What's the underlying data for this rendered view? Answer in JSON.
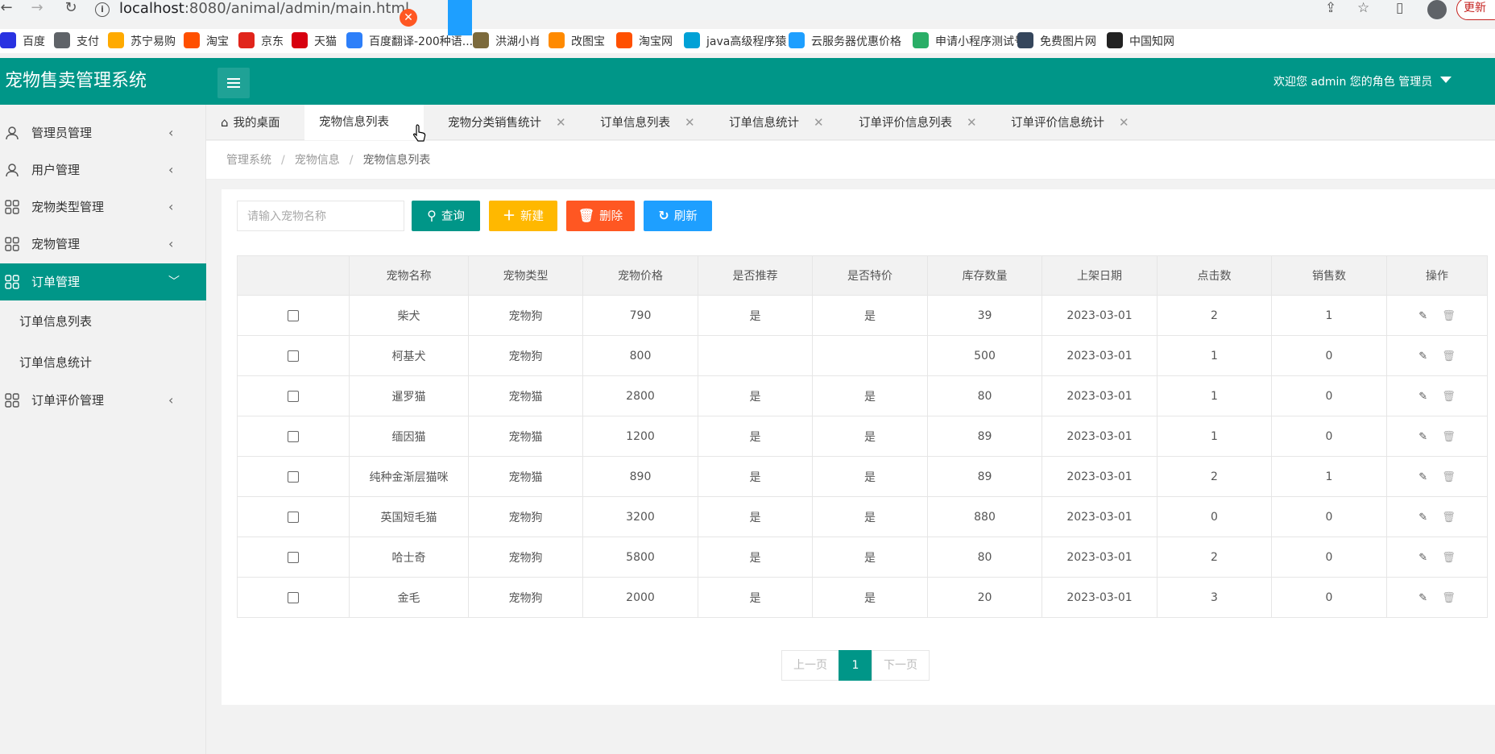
{
  "browser": {
    "url_host": "localhost",
    "url_path": ":8080/animal/admin/main.html",
    "update_label": "更新",
    "bookmarks": [
      {
        "label": "百度",
        "icon": "baidu-icon",
        "color": "#2932e1"
      },
      {
        "label": "支付",
        "icon": "globe-icon",
        "color": "#5f6368"
      },
      {
        "label": "苏宁易购",
        "icon": "suning-icon",
        "color": "#ffaa00"
      },
      {
        "label": "淘宝",
        "icon": "taobao-icon",
        "color": "#ff5000"
      },
      {
        "label": "京东",
        "icon": "jd-icon",
        "color": "#e1251b"
      },
      {
        "label": "天猫",
        "icon": "tmall-icon",
        "color": "#d7000f"
      },
      {
        "label": "百度翻译-200种语...",
        "icon": "fanyi-icon",
        "color": "#2d7ff9"
      },
      {
        "label": "洪湖小肖",
        "icon": "feather-icon",
        "color": "#7c6a3c"
      },
      {
        "label": "改图宝",
        "icon": "gaitubao-icon",
        "color": "#ff8a00"
      },
      {
        "label": "淘宝网",
        "icon": "taobao-icon",
        "color": "#ff5000"
      },
      {
        "label": "java高级程序猿",
        "icon": "bilibili-icon",
        "color": "#00a1d6"
      },
      {
        "label": "云服务器优惠价格",
        "icon": "cloud-icon",
        "color": "#1e9fff"
      },
      {
        "label": "申请小程序测试号",
        "icon": "wechat-icon",
        "color": "#2aae67"
      },
      {
        "label": "免费图片网",
        "icon": "tumblr-icon",
        "color": "#35465c"
      },
      {
        "label": "中国知网",
        "icon": "cnki-icon",
        "color": "#222222"
      }
    ]
  },
  "header": {
    "title": "宠物售卖管理系统",
    "user": "欢迎您 admin 您的角色 管理员"
  },
  "sidebar": {
    "items": [
      {
        "label": "管理员管理",
        "icon": "user-icon"
      },
      {
        "label": "用户管理",
        "icon": "user-icon"
      },
      {
        "label": "宠物类型管理",
        "icon": "grid-icon"
      },
      {
        "label": "宠物管理",
        "icon": "grid-icon"
      },
      {
        "label": "订单管理",
        "icon": "grid-icon",
        "active": true
      },
      {
        "label": "订单评价管理",
        "icon": "grid-icon"
      }
    ],
    "sub_items": [
      "订单信息列表",
      "订单信息统计"
    ]
  },
  "tabs": [
    {
      "label": "我的桌面",
      "icon": "home-icon"
    },
    {
      "label": "宠物信息列表",
      "active": true
    },
    {
      "label": "宠物分类销售统计"
    },
    {
      "label": "订单信息列表"
    },
    {
      "label": "订单信息统计"
    },
    {
      "label": "订单评价信息列表"
    },
    {
      "label": "订单评价信息统计"
    }
  ],
  "tab_close_symbol": "✕",
  "breadcrumb": [
    "管理系统",
    "宠物信息",
    "宠物信息列表"
  ],
  "breadcrumb_sep": "/",
  "toolbar": {
    "search_placeholder": "请输入宠物名称",
    "query_label": "查询",
    "new_label": "新建",
    "delete_label": "删除",
    "refresh_label": "刷新",
    "colors": {
      "query": "#009688",
      "new": "#ffb800",
      "delete": "#ff5722",
      "refresh": "#1e9fff"
    }
  },
  "table": {
    "headers": [
      "宠物名称",
      "宠物类型",
      "宠物价格",
      "是否推荐",
      "是否特价",
      "库存数量",
      "上架日期",
      "点击数",
      "销售数",
      "操作"
    ],
    "rows": [
      [
        "柴犬",
        "宠物狗",
        "790",
        "是",
        "是",
        "39",
        "2023-03-01",
        "2",
        "1"
      ],
      [
        "柯基犬",
        "宠物狗",
        "800",
        "",
        "",
        "500",
        "2023-03-01",
        "1",
        "0"
      ],
      [
        "暹罗猫",
        "宠物猫",
        "2800",
        "是",
        "是",
        "80",
        "2023-03-01",
        "1",
        "0"
      ],
      [
        "缅因猫",
        "宠物猫",
        "1200",
        "是",
        "是",
        "89",
        "2023-03-01",
        "1",
        "0"
      ],
      [
        "纯种金渐层猫咪",
        "宠物猫",
        "890",
        "是",
        "是",
        "89",
        "2023-03-01",
        "2",
        "1"
      ],
      [
        "英国短毛猫",
        "宠物狗",
        "3200",
        "是",
        "是",
        "880",
        "2023-03-01",
        "0",
        "0"
      ],
      [
        "哈士奇",
        "宠物狗",
        "5800",
        "是",
        "是",
        "80",
        "2023-03-01",
        "2",
        "0"
      ],
      [
        "金毛",
        "宠物狗",
        "2000",
        "是",
        "是",
        "20",
        "2023-03-01",
        "3",
        "0"
      ]
    ]
  },
  "pager": {
    "prev": "上一页",
    "current": "1",
    "next": "下一页"
  }
}
